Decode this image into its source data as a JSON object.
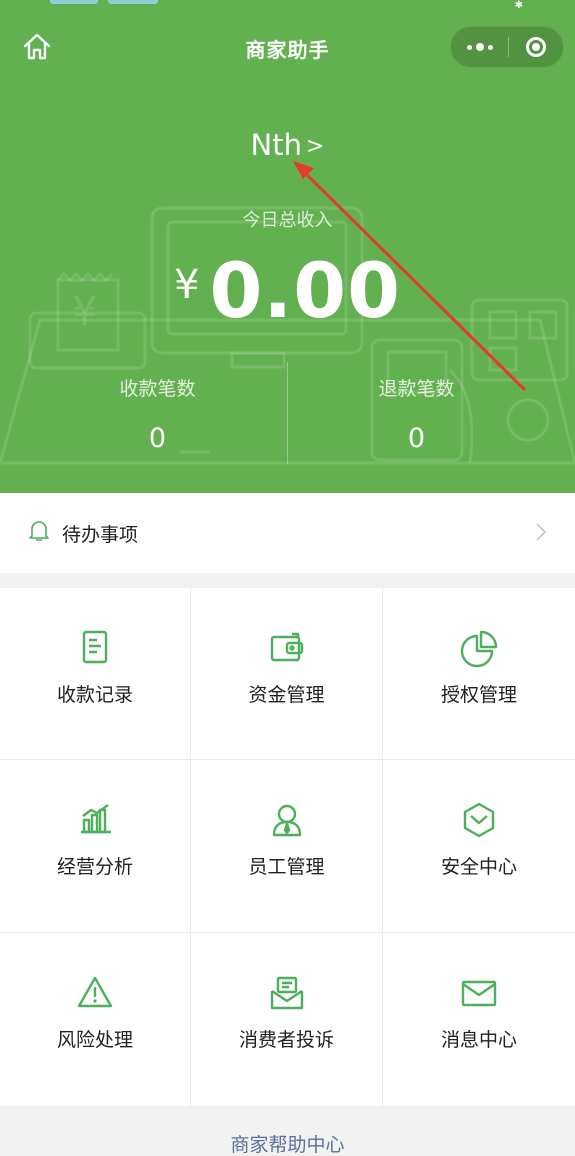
{
  "colors": {
    "brand_green": "#62b04f",
    "icon_green": "#4cb05a",
    "link_blue": "#5b6fa0",
    "arrow_red": "#e53a2f"
  },
  "nav": {
    "title": "商家助手"
  },
  "shop": {
    "name": "Nth"
  },
  "income": {
    "label": "今日总收入",
    "currency": "¥",
    "amount": "0.00"
  },
  "stats": [
    {
      "label": "收款笔数",
      "value": "0"
    },
    {
      "label": "退款笔数",
      "value": "0"
    }
  ],
  "todo": {
    "label": "待办事项",
    "icon": "bell-icon"
  },
  "menu": [
    {
      "label": "收款记录",
      "icon": "receipt-icon"
    },
    {
      "label": "资金管理",
      "icon": "wallet-icon"
    },
    {
      "label": "授权管理",
      "icon": "pie-chart-icon"
    },
    {
      "label": "经营分析",
      "icon": "bar-chart-icon"
    },
    {
      "label": "员工管理",
      "icon": "staff-icon"
    },
    {
      "label": "安全中心",
      "icon": "shield-icon"
    },
    {
      "label": "风险处理",
      "icon": "warning-icon"
    },
    {
      "label": "消费者投诉",
      "icon": "complaint-icon"
    },
    {
      "label": "消息中心",
      "icon": "envelope-icon"
    }
  ],
  "help": {
    "label": "商家帮助中心"
  }
}
